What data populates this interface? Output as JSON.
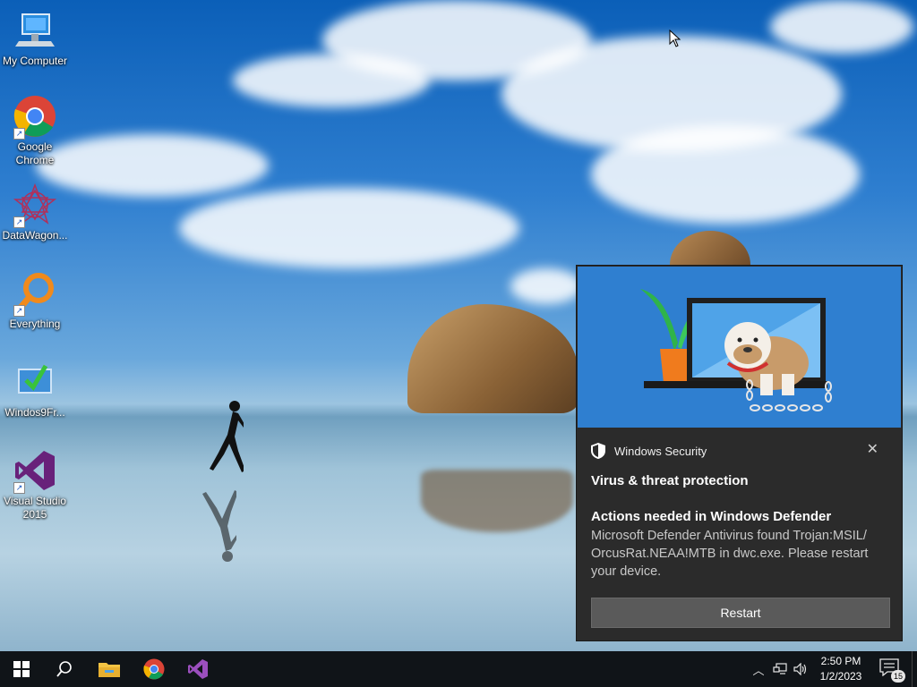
{
  "desktop": {
    "icons": [
      {
        "label": "My Computer",
        "icon": "computer-icon"
      },
      {
        "label": "Google Chrome",
        "icon": "chrome-icon"
      },
      {
        "label": "DataWagon...",
        "icon": "datawagon-icon"
      },
      {
        "label": "Everything",
        "icon": "everything-search-icon"
      },
      {
        "label": "Windos9Fr...",
        "icon": "installer-icon"
      },
      {
        "label": "Visual Studio 2015",
        "icon": "visual-studio-icon"
      }
    ]
  },
  "notification": {
    "app_name": "Windows Security",
    "title": "Virus & threat protection",
    "subtitle": "Actions needed in Windows Defender",
    "body": "Microsoft Defender Antivirus found Trojan:MSIL/ OrcusRat.NEAA!MTB in dwc.exe. Please restart your device.",
    "button_label": "Restart",
    "close_symbol": "✕"
  },
  "taskbar": {
    "pinned": [
      "start-icon",
      "search-icon",
      "file-explorer-icon",
      "chrome-icon",
      "visual-studio-icon"
    ],
    "time": "2:50 PM",
    "date": "1/2/2023",
    "notification_count": "15"
  },
  "colors": {
    "accent": "#76b9ed",
    "taskbar": "#101418",
    "toast_bg": "#2b2b2b",
    "hero_bg": "#2f7fd0"
  }
}
